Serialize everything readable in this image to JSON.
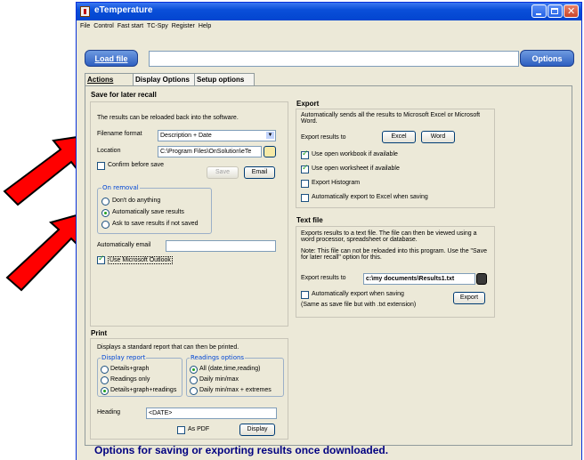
{
  "window": {
    "title": "eTemperature"
  },
  "menu": [
    "File",
    "Control",
    "Fast start",
    "TC-Spy",
    "Register",
    "Help"
  ],
  "toolbar": {
    "load_label": "Load file",
    "options_label": "Options",
    "path_value": ""
  },
  "tabs": [
    "Actions",
    "Display Options",
    "Setup options"
  ],
  "save": {
    "title": "Save for later recall",
    "desc": "The results can be reloaded back into the software.",
    "format_label": "Filename format",
    "format_value": "Description + Date",
    "location_label": "Location",
    "location_value": "C:\\Program Files\\OnSolution\\eTe",
    "confirm_label": "Confirm before save",
    "save_btn": "Save",
    "email_btn": "Email",
    "on_removal_label": "On removal",
    "removal_options": [
      "Don't do anything",
      "Automatically save results",
      "Ask to save results if not saved"
    ],
    "auto_email_label": "Automatically email",
    "auto_email_value": "",
    "outlook_label": "Use Microsoft Outlook"
  },
  "export": {
    "title": "Export",
    "desc": "Automatically sends all the results to Microsoft Excel or Microsoft Word.",
    "export_to_label": "Export results to",
    "excel_btn": "Excel",
    "word_btn": "Word",
    "checks": [
      "Use open workbook if available",
      "Use open worksheet if available",
      "Export Histogram",
      "Automatically export to Excel when saving"
    ]
  },
  "textfile": {
    "title": "Text file",
    "desc": "Exports results to a text file. The file can then be viewed using a word processor, spreadsheet or database.",
    "note": "Note: This file can not be reloaded into this program. Use the \"Save for later recall\" option for this.",
    "export_to_label": "Export results to",
    "path_value": "c:\\my documents\\Results1.txt",
    "auto_label": "Automatically export when saving",
    "auto_sub": "(Same as save file but with .txt extension)",
    "export_btn": "Export"
  },
  "print": {
    "title": "Print",
    "desc": "Displays a standard report that can then be printed.",
    "display_report_label": "Display report",
    "display_options": [
      "Details+graph",
      "Readings only",
      "Details+graph+readings"
    ],
    "readings_label": "Readings options",
    "readings_options": [
      "All (date,time,reading)",
      "Daily min/max",
      "Daily min/max + extremes"
    ],
    "heading_label": "Heading",
    "heading_value": "<DATE>",
    "pdf_label": "As PDF",
    "display_btn": "Display"
  },
  "footer": "Options for saving or exporting results once downloaded.",
  "colors": {
    "title_bar": "#0a4fd9",
    "arrow": "#ff0000",
    "footer_text": "#000080"
  }
}
